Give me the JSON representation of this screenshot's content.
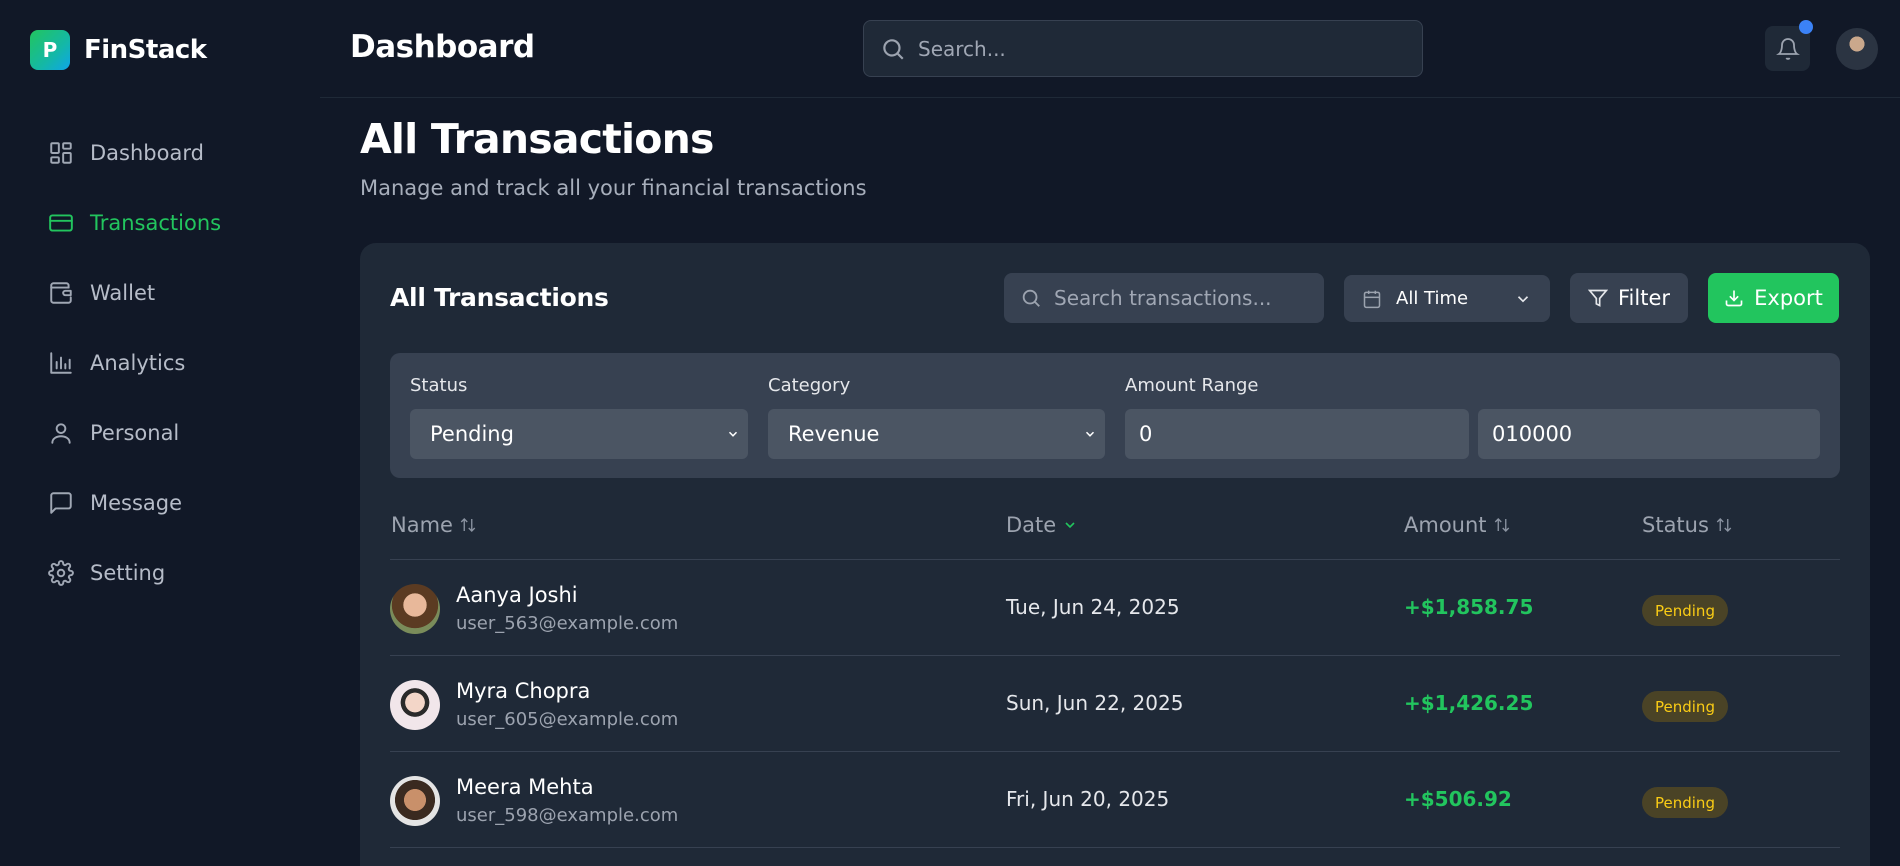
{
  "brand": {
    "logo_letter": "P",
    "name": "FinStack"
  },
  "sidebar": {
    "items": [
      {
        "label": "Dashboard",
        "icon": "dashboard-icon",
        "active": false
      },
      {
        "label": "Transactions",
        "icon": "credit-card-icon",
        "active": true
      },
      {
        "label": "Wallet",
        "icon": "wallet-icon",
        "active": false
      },
      {
        "label": "Analytics",
        "icon": "bar-chart-icon",
        "active": false
      },
      {
        "label": "Personal",
        "icon": "user-icon",
        "active": false
      },
      {
        "label": "Message",
        "icon": "message-icon",
        "active": false
      },
      {
        "label": "Setting",
        "icon": "gear-icon",
        "active": false
      }
    ]
  },
  "header": {
    "title": "Dashboard",
    "search_placeholder": "Search...",
    "notification_dot_color": "#3b82f6"
  },
  "page": {
    "title": "All Transactions",
    "subtitle": "Manage and track all your financial transactions"
  },
  "card": {
    "title": "All Transactions",
    "search_placeholder": "Search transactions...",
    "time_filter": "All Time",
    "filter_label": "Filter",
    "export_label": "Export"
  },
  "filters": {
    "status_label": "Status",
    "status_value": "Pending",
    "category_label": "Category",
    "category_value": "Revenue",
    "amount_label": "Amount Range",
    "amount_min": "0",
    "amount_max": "010000"
  },
  "table": {
    "columns": {
      "name": "Name",
      "date": "Date",
      "amount": "Amount",
      "status": "Status"
    },
    "rows": [
      {
        "name": "Aanya Joshi",
        "email": "user_563@example.com",
        "date": "Tue, Jun 24, 2025",
        "amount": "+$1,858.75",
        "status": "Pending"
      },
      {
        "name": "Myra Chopra",
        "email": "user_605@example.com",
        "date": "Sun, Jun 22, 2025",
        "amount": "+$1,426.25",
        "status": "Pending"
      },
      {
        "name": "Meera Mehta",
        "email": "user_598@example.com",
        "date": "Fri, Jun 20, 2025",
        "amount": "+$506.92",
        "status": "Pending"
      }
    ]
  },
  "colors": {
    "accent": "#22c55e",
    "background": "#111827",
    "card": "#1f2937",
    "pending_text": "#facc15"
  }
}
